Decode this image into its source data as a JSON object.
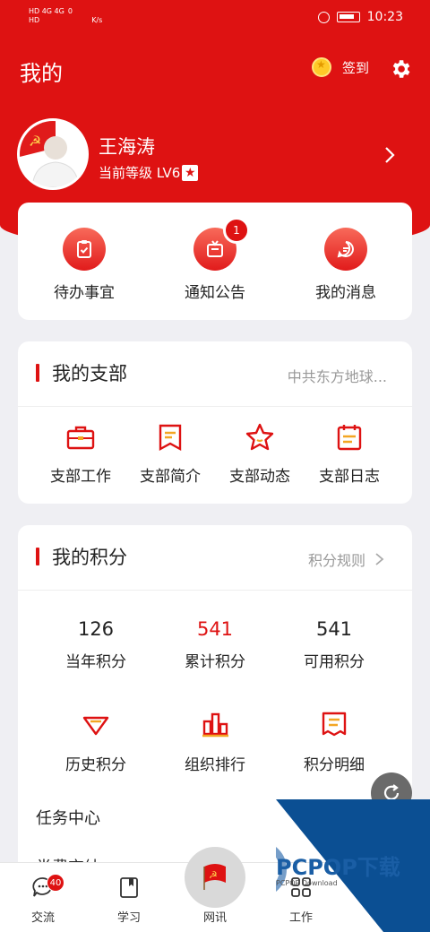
{
  "status_bar": {
    "left_line1": "HD 4G 4G",
    "left_line2": "HD",
    "net_speed": "0",
    "net_unit": "K/s",
    "time": "10:23"
  },
  "header": {
    "title": "我的",
    "signin_label": "签到"
  },
  "profile": {
    "name": "王海涛",
    "level_text": "当前等级 LV6"
  },
  "quick_actions": [
    {
      "label": "待办事宜",
      "icon": "clipboard-check-icon"
    },
    {
      "label": "通知公告",
      "icon": "announcement-icon",
      "badge": "1"
    },
    {
      "label": "我的消息",
      "icon": "chat-icon"
    }
  ],
  "branch": {
    "title": "我的支部",
    "org_name": "中共东方地球...",
    "items": [
      {
        "label": "支部工作",
        "icon": "briefcase-icon"
      },
      {
        "label": "支部简介",
        "icon": "bookmark-icon"
      },
      {
        "label": "支部动态",
        "icon": "star-icon"
      },
      {
        "label": "支部日志",
        "icon": "calendar-icon"
      }
    ]
  },
  "points": {
    "title": "我的积分",
    "rules_label": "积分规则",
    "stats": [
      {
        "value": "126",
        "label": "当年积分"
      },
      {
        "value": "541",
        "label": "累计积分"
      },
      {
        "value": "541",
        "label": "可用积分"
      }
    ],
    "links": [
      {
        "label": "历史积分",
        "icon": "diamond-icon"
      },
      {
        "label": "组织排行",
        "icon": "bar-chart-icon"
      },
      {
        "label": "积分明细",
        "icon": "receipt-icon"
      }
    ],
    "task_center": "任务中心",
    "next_row": "党费交纳"
  },
  "tabbar": {
    "items": [
      {
        "label": "交流",
        "badge": "40"
      },
      {
        "label": "学习"
      },
      {
        "label": "网讯"
      },
      {
        "label": "工作"
      }
    ]
  },
  "watermark": {
    "brand": "PCPOP下载",
    "sub": "PCPOP Download"
  },
  "colors": {
    "primary_red": "#de1212",
    "background": "#efeff3",
    "watermark_blue": "#0b4f93"
  }
}
